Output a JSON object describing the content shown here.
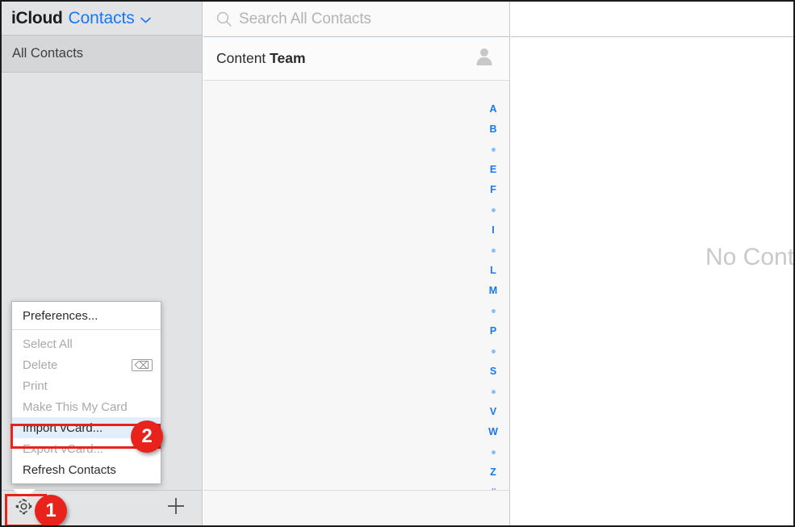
{
  "window": {
    "brand_primary": "iCloud",
    "brand_app": "Contacts",
    "brand_caret_icon": "chevron-down-icon",
    "accent_color": "#1878f0",
    "annotation_color": "#e8231b"
  },
  "sidebar": {
    "group_row_label": "All Contacts",
    "gear_icon": "gear-icon",
    "add_icon": "plus-icon"
  },
  "context_menu": {
    "items": [
      {
        "label": "Preferences...",
        "state": "enabled",
        "shortcut": ""
      },
      {
        "label": "Select All",
        "state": "disabled",
        "shortcut": ""
      },
      {
        "label": "Delete",
        "state": "disabled",
        "shortcut": "⌫"
      },
      {
        "label": "Print",
        "state": "disabled",
        "shortcut": ""
      },
      {
        "label": "Make This My Card",
        "state": "disabled",
        "shortcut": ""
      },
      {
        "label": "Import vCard...",
        "state": "highlighted",
        "shortcut": ""
      },
      {
        "label": "Export vCard...",
        "state": "disabled",
        "shortcut": ""
      },
      {
        "label": "Refresh Contacts",
        "state": "enabled",
        "shortcut": ""
      }
    ]
  },
  "search": {
    "placeholder": "Search All Contacts",
    "value": "",
    "icon": "search-icon"
  },
  "list": {
    "title_regular": "Content ",
    "title_bold": "Team",
    "avatar_icon": "person-icon",
    "alpha_index": [
      "A",
      "B",
      "•",
      "E",
      "F",
      "•",
      "I",
      "•",
      "L",
      "M",
      "•",
      "P",
      "•",
      "S",
      "•",
      "V",
      "W",
      "•",
      "Z",
      "#"
    ]
  },
  "detail": {
    "empty_message": "No Contact Selected"
  },
  "annotations": {
    "step_one": "1",
    "step_two": "2"
  }
}
